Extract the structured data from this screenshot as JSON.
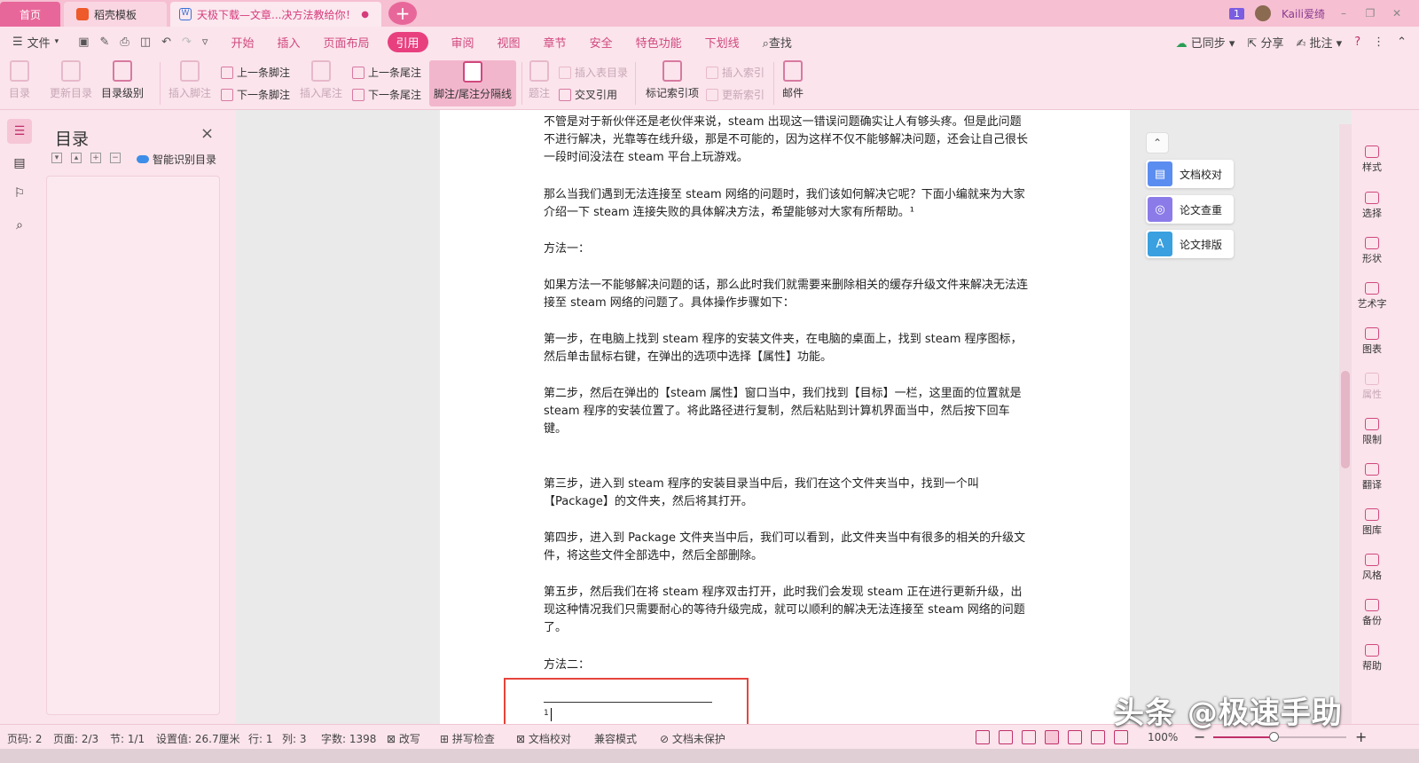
{
  "tabs": {
    "home": "首页",
    "daoke": "稻壳模板",
    "doc": "天极下载—文章...决方法教给你！",
    "doc_dot": "●",
    "new_tab": "+"
  },
  "titlebar": {
    "badge": "1",
    "user": "Kaili爱绮"
  },
  "menu": {
    "file": "文件",
    "tabs": [
      "开始",
      "插入",
      "页面布局",
      "引用",
      "审阅",
      "视图",
      "章节",
      "安全",
      "特色功能",
      "下划线"
    ],
    "active_index": 3,
    "find": "查找",
    "synced": "已同步",
    "share": "分享",
    "comment": "批注",
    "help": "?"
  },
  "ribbon": {
    "toc": "目录",
    "update_toc": "更新目录",
    "toc_level": "目录级别",
    "insert_footnote": "插入脚注",
    "prev_footnote": "上一条脚注",
    "next_footnote": "下一条脚注",
    "insert_endnote": "插入尾注",
    "prev_endnote": "上一条尾注",
    "next_endnote": "下一条尾注",
    "fn_separator": "脚注/尾注分隔线",
    "caption": "题注",
    "insert_table_toc": "插入表目录",
    "cross_ref": "交叉引用",
    "mark_index": "标记索引项",
    "insert_index": "插入索引",
    "update_index": "更新索引",
    "mail": "邮件"
  },
  "toc_panel": {
    "title": "目录",
    "close": "×",
    "smart": "智能识别目录"
  },
  "document": {
    "paragraphs": [
      "不管是对于新伙伴还是老伙伴来说，steam 出现这一错误问题确实让人有够头疼。但是此问题不进行解决，光靠等在线升级，那是不可能的，因为这样不仅不能够解决问题，还会让自己很长一段时间没法在 steam 平台上玩游戏。",
      "那么当我们遇到无法连接至 steam 网络的问题时，我们该如何解决它呢？下面小编就来为大家介绍一下 steam 连接失败的具体解决方法，希望能够对大家有所帮助。¹",
      "方法一：",
      "如果方法一不能够解决问题的话，那么此时我们就需要来删除相关的缓存升级文件来解决无法连接至 steam 网络的问题了。具体操作步骤如下：",
      "第一步，在电脑上找到 steam 程序的安装文件夹，在电脑的桌面上，找到 steam 程序图标，然后单击鼠标右键，在弹出的选项中选择【属性】功能。",
      "第二步，然后在弹出的【steam 属性】窗口当中，我们找到【目标】一栏，这里面的位置就是 steam 程序的安装位置了。将此路径进行复制，然后粘贴到计算机界面当中，然后按下回车键。",
      "第三步，进入到 steam 程序的安装目录当中后，我们在这个文件夹当中，找到一个叫【Package】的文件夹，然后将其打开。",
      "第四步，进入到 Package 文件夹当中后，我们可以看到，此文件夹当中有很多的相关的升级文件，将这些文件全部选中，然后全部删除。",
      "第五步，然后我们在将 steam 程序双击打开，此时我们会发现 steam 正在进行更新升级，出现这种情况我们只需要耐心的等待升级完成，就可以顺利的解决无法连接至 steam 网络的问题了。",
      "方法二："
    ],
    "footnote_mark": "1"
  },
  "float_tools": {
    "collapse": "⌃",
    "proofread": "文档校对",
    "plagiarism": "论文查重",
    "format": "论文排版"
  },
  "right_rail": [
    "样式",
    "选择",
    "形状",
    "艺术字",
    "图表",
    "属性",
    "限制",
    "翻译",
    "图库",
    "风格",
    "备份",
    "帮助"
  ],
  "status": {
    "page": "页码: 2",
    "pages": "页面: 2/3",
    "section": "节: 1/1",
    "setting": "设置值: 26.7厘米",
    "row": "行: 1",
    "col": "列: 3",
    "words": "字数: 1398",
    "revise": "改写",
    "spell": "拼写检查",
    "proof": "文档校对",
    "compat": "兼容模式",
    "protect": "文档未保护",
    "zoom": "100%",
    "zoom_value": 0.45
  },
  "watermark": "头条 @极速手助"
}
